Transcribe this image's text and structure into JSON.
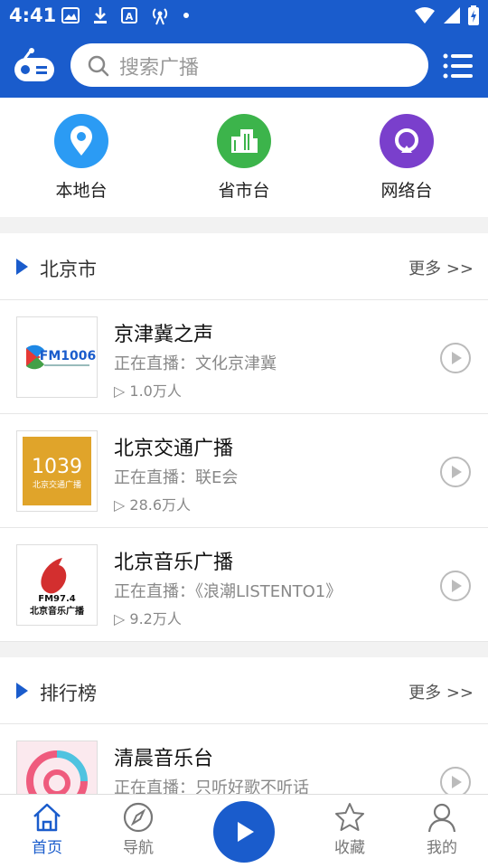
{
  "status": {
    "time": "4:41"
  },
  "search": {
    "placeholder": "搜索广播"
  },
  "categories": [
    {
      "label": "本地台",
      "color": "#2b9bf4",
      "icon": "location-pin-icon"
    },
    {
      "label": "省市台",
      "color": "#3cb44b",
      "icon": "buildings-icon"
    },
    {
      "label": "网络台",
      "color": "#7a3fcc",
      "icon": "network-icon"
    }
  ],
  "sections": [
    {
      "title": "北京市",
      "more": "更多 >>",
      "stations": [
        {
          "name": "京津冀之声",
          "live": "正在直播：文化京津冀",
          "count": "▷ 1.0万人",
          "logo_text": "FM1006"
        },
        {
          "name": "北京交通广播",
          "live": "正在直播：联E会",
          "count": "▷ 28.6万人",
          "logo_text": "1039",
          "logo_sub": "北京交通广播"
        },
        {
          "name": "北京音乐广播",
          "live": "正在直播：《浪潮LISTENTO1》",
          "count": "▷ 9.2万人",
          "logo_text": "FM97.4",
          "logo_sub": "北京音乐广播"
        }
      ]
    },
    {
      "title": "排行榜",
      "more": "更多 >>",
      "stations": [
        {
          "name": "清晨音乐台",
          "live": "正在直播：只听好歌不听话"
        }
      ]
    }
  ],
  "tabs": [
    {
      "label": "首页",
      "active": true
    },
    {
      "label": "导航"
    },
    {
      "label": "收藏"
    },
    {
      "label": "我的"
    }
  ],
  "colors": {
    "accent": "#1a5ccc"
  }
}
